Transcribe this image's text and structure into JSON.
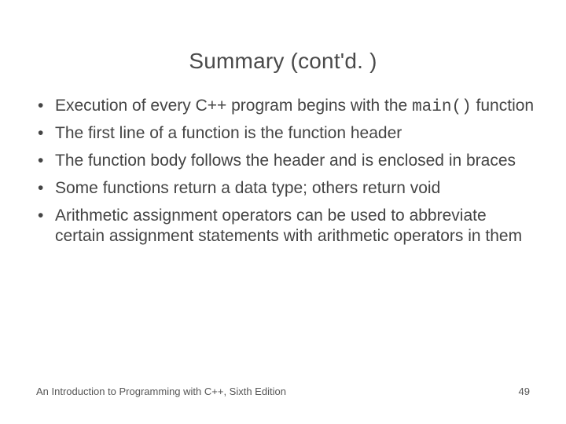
{
  "title": "Summary (cont'd. )",
  "bullets": [
    {
      "pre": "Execution of every C++ program begins with the ",
      "code": "main()",
      "post": " function"
    },
    {
      "pre": "The first line of a function is the function header",
      "code": "",
      "post": ""
    },
    {
      "pre": "The function body follows the header and is enclosed in braces",
      "code": "",
      "post": ""
    },
    {
      "pre": "Some functions return a data type; others return void",
      "code": "",
      "post": ""
    },
    {
      "pre": "Arithmetic assignment operators can be used to abbreviate certain assignment statements with arithmetic operators in them",
      "code": "",
      "post": ""
    }
  ],
  "footer": {
    "book": "An Introduction to Programming with C++, Sixth Edition",
    "page": "49"
  }
}
